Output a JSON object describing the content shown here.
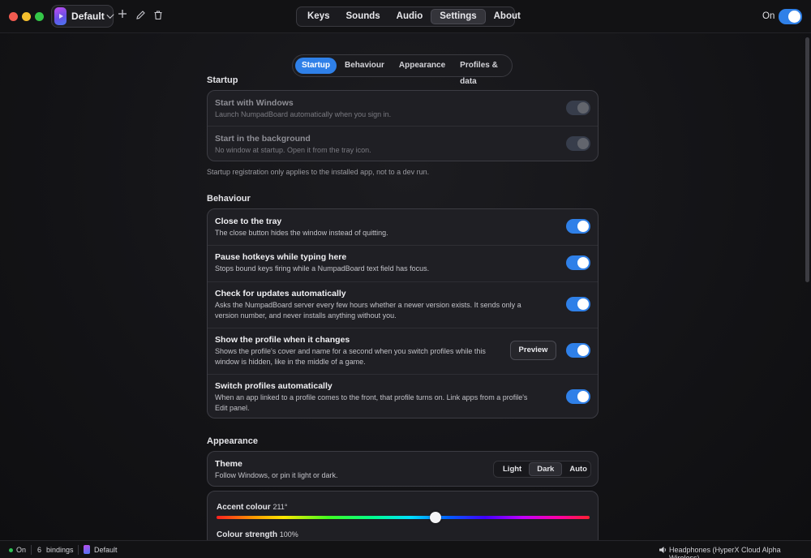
{
  "titlebar": {
    "profile_name": "Default",
    "main_tabs": [
      {
        "label": "Keys",
        "active": false
      },
      {
        "label": "Sounds",
        "active": false
      },
      {
        "label": "Audio",
        "active": false
      },
      {
        "label": "Settings",
        "active": true
      },
      {
        "label": "About",
        "active": false
      }
    ],
    "power_label": "On",
    "power_on": true
  },
  "sub_tabs": [
    {
      "label": "Startup",
      "active": true
    },
    {
      "label": "Behaviour",
      "active": false
    },
    {
      "label": "Appearance",
      "active": false
    },
    {
      "label": "Profiles & data",
      "active": false
    }
  ],
  "startup": {
    "heading": "Startup",
    "rows": [
      {
        "title": "Start with Windows",
        "desc": "Launch NumpadBoard automatically when you sign in.",
        "on": true,
        "disabled": true
      },
      {
        "title": "Start in the background",
        "desc": "No window at startup. Open it from the tray icon.",
        "on": true,
        "disabled": true
      }
    ],
    "note": "Startup registration only applies to the installed app, not to a dev run."
  },
  "behaviour": {
    "heading": "Behaviour",
    "rows": [
      {
        "title": "Close to the tray",
        "desc": "The close button hides the window instead of quitting.",
        "on": true
      },
      {
        "title": "Pause hotkeys while typing here",
        "desc": "Stops bound keys firing while a NumpadBoard text field has focus.",
        "on": true
      },
      {
        "title": "Check for updates automatically",
        "desc": "Asks the NumpadBoard server every few hours whether a newer version exists. It sends only a version number, and never installs anything without you.",
        "on": true
      },
      {
        "title": "Show the profile when it changes",
        "desc": "Shows the profile's cover and name for a second when you switch profiles while this window is hidden, like in the middle of a game.",
        "on": true,
        "button": "Preview"
      },
      {
        "title": "Switch profiles automatically",
        "desc": "When an app linked to a profile comes to the front, that profile turns on. Link apps from a profile's Edit panel.",
        "on": true
      }
    ]
  },
  "appearance": {
    "heading": "Appearance",
    "theme": {
      "title": "Theme",
      "desc": "Follow Windows, or pin it light or dark.",
      "options": [
        {
          "label": "Light",
          "active": false
        },
        {
          "label": "Dark",
          "active": true
        },
        {
          "label": "Auto",
          "active": false
        }
      ]
    },
    "accent": {
      "label": "Accent colour",
      "value": "211°",
      "hue": 211
    },
    "strength": {
      "label": "Colour strength",
      "value": "100%"
    }
  },
  "statusbar": {
    "state": "On",
    "bindings_count": "6",
    "bindings_label": "bindings",
    "profile": "Default",
    "audio_device": "Headphones (HyperX Cloud Alpha Wireless)"
  },
  "colors": {
    "accent": "#2f80e8",
    "status_on": "#2ec255"
  }
}
